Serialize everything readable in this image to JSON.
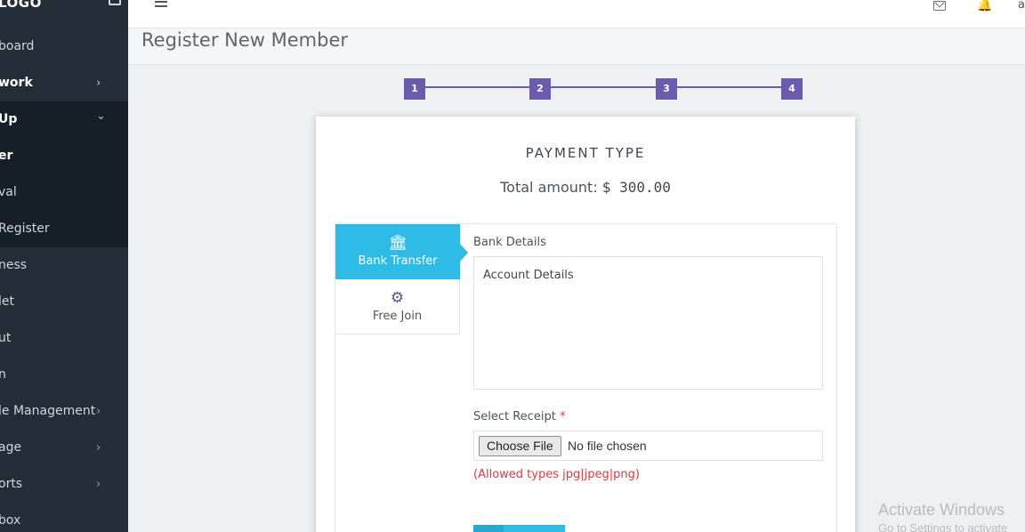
{
  "sidebar": {
    "logo": "LOGO",
    "items": [
      {
        "label": "board"
      },
      {
        "label": "work"
      },
      {
        "label": "Up"
      },
      {
        "label": "er"
      },
      {
        "label": "val"
      },
      {
        "label": "Register"
      },
      {
        "label": "ness"
      },
      {
        "label": "let"
      },
      {
        "label": "ut"
      },
      {
        "label": "n"
      },
      {
        "label": "le Management"
      },
      {
        "label": "age"
      },
      {
        "label": "orts"
      },
      {
        "label": "box"
      }
    ],
    "chevron_right": "›",
    "chevron_down": "⌄"
  },
  "topbar": {
    "user_initial": "a",
    "bell": "🔔"
  },
  "page": {
    "title": "Register New Member"
  },
  "stepper": {
    "steps": [
      "1",
      "2",
      "3",
      "4"
    ]
  },
  "payment": {
    "title": "PAYMENT TYPE",
    "total_label": "Total amount:",
    "total_value": "$ 300.00",
    "tabs": [
      {
        "label": "Bank Transfer",
        "icon": "bank-icon",
        "glyph": "🏛"
      },
      {
        "label": "Free Join",
        "icon": "gear-icon",
        "glyph": "⚙"
      }
    ],
    "bank_details_label": "Bank Details",
    "account_details": "Account Details",
    "receipt_label": "Select Receipt",
    "required_mark": "*",
    "file_button": "Choose File",
    "file_status": "No file chosen",
    "allowed_types": "(Allowed types jpg|jpeg|png)"
  },
  "watermark": {
    "line1": "Activate Windows",
    "line2": "Go to Settings to activate"
  },
  "colors": {
    "sidebar_bg": "#222d38",
    "step_purple": "#6b5bad",
    "tab_active": "#2ebbe6",
    "error_red": "#e0393e"
  }
}
